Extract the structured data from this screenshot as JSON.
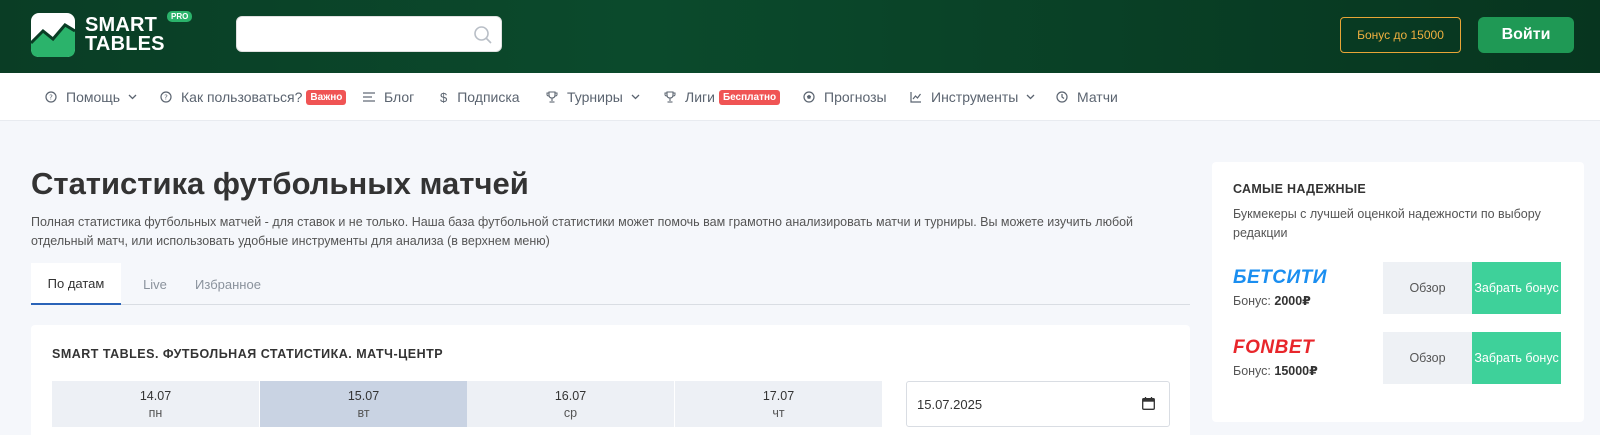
{
  "header": {
    "logo_line1": "SMART",
    "logo_line2": "TABLES",
    "logo_badge": "PRO",
    "search_placeholder": "",
    "bonus_label": "Бонус до 15000",
    "login_label": "Войти"
  },
  "nav": {
    "items": [
      {
        "label": "Помощь",
        "icon": "help-circle-icon"
      },
      {
        "label": "Как пользоваться?",
        "icon": "help-circle-icon",
        "badge": "Важно"
      },
      {
        "label": "Блог",
        "icon": "lines-icon"
      },
      {
        "label": "Подписка",
        "icon": "dollar-icon"
      },
      {
        "label": "Турниры",
        "icon": "trophy-icon"
      },
      {
        "label": "Лиги",
        "icon": "trophy-icon",
        "badge": "Бесплатно"
      },
      {
        "label": "Прогнозы",
        "icon": "ball-icon"
      },
      {
        "label": "Инструменты",
        "icon": "chart-icon"
      },
      {
        "label": "Матчи",
        "icon": "clock-icon"
      }
    ]
  },
  "main": {
    "title": "Статистика футбольных матчей",
    "description": "Полная статистика футбольных матчей - для ставок и не только. Наша база футбольной статистики может помочь вам грамотно анализировать матчи и турниры. Вы можете изучить любой отдельный матч, или использовать удобные инструменты для анализа (в верхнем меню)",
    "tabs": [
      {
        "label": "По датам",
        "active": true
      },
      {
        "label": "Live",
        "active": false
      },
      {
        "label": "Избранное",
        "active": false
      }
    ],
    "card_title": "SMART TABLES. ФУТБОЛЬНАЯ СТАТИСТИКА. МАТЧ-ЦЕНТР",
    "days": [
      {
        "date": "14.07",
        "day": "пн",
        "active": false
      },
      {
        "date": "15.07",
        "day": "вт",
        "active": true
      },
      {
        "date": "16.07",
        "day": "ср",
        "active": false
      },
      {
        "date": "17.07",
        "day": "чт",
        "active": false
      }
    ],
    "date_value": "15.07.2025"
  },
  "sidebar": {
    "title": "САМЫЕ НАДЕЖНЫЕ",
    "subtitle": "Букмекеры с лучшей оценкой надежности по выбору редакции",
    "bookmakers": [
      {
        "name": "БЕТСИТИ",
        "color": "#1a8ef0",
        "bonus_label": "Бонус:",
        "bonus_value": "2000₽",
        "review_label": "Обзор",
        "take_label": "Забрать бонус"
      },
      {
        "name": "FONBET",
        "color": "#e8262b",
        "bonus_label": "Бонус:",
        "bonus_value": "15000₽",
        "review_label": "Обзор",
        "take_label": "Забрать бонус"
      }
    ]
  }
}
